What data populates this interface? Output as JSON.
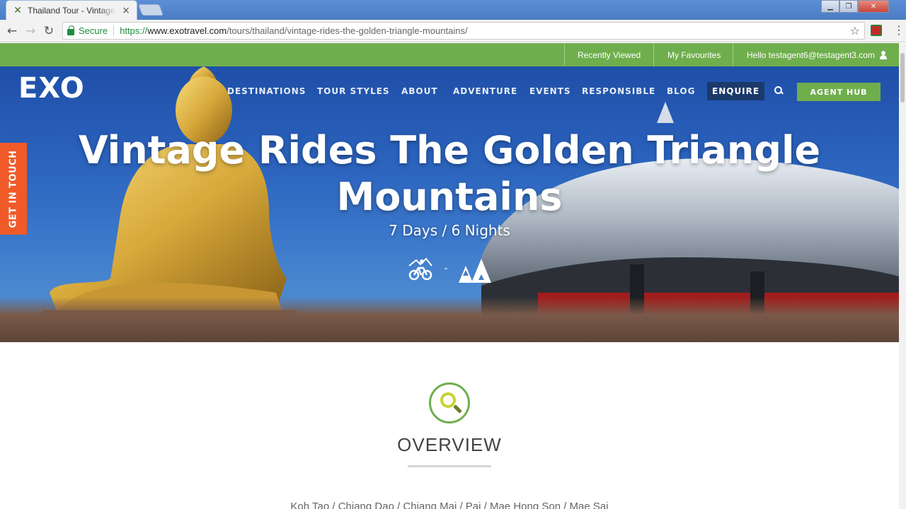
{
  "browser": {
    "tab_title": "Thailand Tour - Vintage R",
    "tab_close": "×",
    "secure_label": "Secure",
    "url_proto": "https://",
    "url_host": "www.exotravel.com",
    "url_path": "/tours/thailand/vintage-rides-the-golden-triangle-mountains/",
    "back": "←",
    "forward": "→",
    "reload": "↻",
    "star": "☆",
    "menu": "⋮"
  },
  "utility_bar": {
    "recently_viewed": "Recently Viewed",
    "my_favourites": "My Favourites",
    "hello_user": "Hello testagent6@testagent3.com"
  },
  "site": {
    "logo": "EXO",
    "nav": [
      {
        "label": "DESTINATIONS"
      },
      {
        "label": "TOUR STYLES"
      },
      {
        "label": "ABOUT"
      },
      {
        "label": "ADVENTURE"
      },
      {
        "label": "EVENTS"
      },
      {
        "label": "RESPONSIBLE"
      },
      {
        "label": "BLOG"
      },
      {
        "label": "ENQUIRE"
      }
    ],
    "agent_hub": "AGENT HUB",
    "get_in_touch": "GET IN TOUCH"
  },
  "hero": {
    "title": "Vintage Rides The Golden Triangle Mountains",
    "subtitle": "7 Days / 6 Nights",
    "icon_separator": "-"
  },
  "overview": {
    "title": "OVERVIEW",
    "route": "Koh Tao / Chiang Dao / Chiang Mai / Pai / Mae Hong Son / Mae Sai"
  },
  "colors": {
    "brand_green": "#6fae4d",
    "get_in_touch_orange": "#f05a28",
    "enquire_navy": "#1b3a6b"
  },
  "icons": [
    "exo-favicon",
    "lock-icon",
    "star-icon",
    "search-icon",
    "user-icon",
    "cycling-icon",
    "mountains-icon",
    "magnifier-icon"
  ]
}
